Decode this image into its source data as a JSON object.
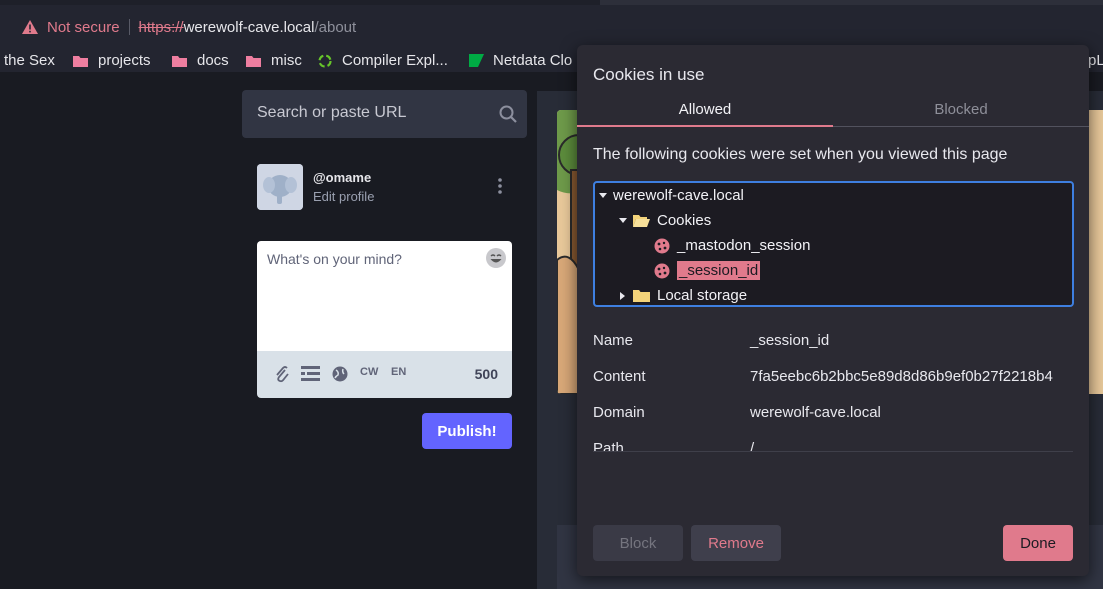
{
  "browser": {
    "security_label": "Not secure",
    "url_scheme": "https://",
    "url_host": "werewolf-cave.local",
    "url_path": "/about"
  },
  "bookmarks": [
    {
      "label": "the Sex",
      "icon": "none"
    },
    {
      "label": "projects",
      "icon": "folder-icon"
    },
    {
      "label": "docs",
      "icon": "folder-icon"
    },
    {
      "label": "misc",
      "icon": "folder-icon"
    },
    {
      "label": "Compiler Expl...",
      "icon": "compiler-explorer-icon"
    },
    {
      "label": "Netdata Clo",
      "icon": "netdata-icon"
    }
  ],
  "mastodon": {
    "search_placeholder": "Search or paste URL",
    "handle": "@omame",
    "edit_profile": "Edit profile",
    "compose_placeholder": "What's on your mind?",
    "cw_label": "CW",
    "lang_label": "EN",
    "char_count": "500",
    "publish_label": "Publish!",
    "accent": "#6364ff"
  },
  "cookies_dialog": {
    "title": "Cookies in use",
    "tabs": {
      "allowed": "Allowed",
      "blocked": "Blocked"
    },
    "description": "The following cookies were set when you viewed this page",
    "tree": {
      "site": "werewolf-cave.local",
      "cookies_folder": "Cookies",
      "cookie1": "_mastodon_session",
      "cookie2": "_session_id",
      "local_storage": "Local storage"
    },
    "details": {
      "name_label": "Name",
      "name_value": "_session_id",
      "content_label": "Content",
      "content_value": "7fa5eebc6b2bbc5e89d8d86b9ef0b27f2218b4",
      "domain_label": "Domain",
      "domain_value": "werewolf-cave.local",
      "path_label": "Path",
      "path_value": "/"
    },
    "buttons": {
      "block": "Block",
      "remove": "Remove",
      "done": "Done"
    },
    "accent": "#e07a8c",
    "focus_color": "#3e7fe0"
  }
}
